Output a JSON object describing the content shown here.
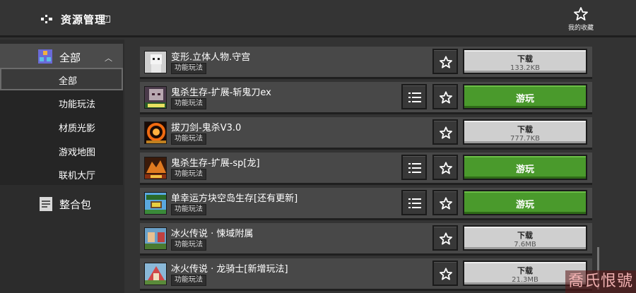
{
  "header": {
    "title": "资源管理",
    "help": "?",
    "favorites_label": "我的收藏"
  },
  "sidebar": {
    "category": {
      "label": "全部",
      "arrow": "︿"
    },
    "subitems": [
      {
        "label": "全部",
        "selected": true
      },
      {
        "label": "功能玩法"
      },
      {
        "label": "材质光影"
      },
      {
        "label": "游戏地图"
      },
      {
        "label": "联机大厅"
      }
    ],
    "pack_label": "整合包"
  },
  "items": [
    {
      "title": "变形.立体人物.守宫",
      "tag": "功能玩法",
      "action": "下载",
      "size": "133.2KB"
    },
    {
      "title": "鬼杀生存-扩展-斩鬼刀ex",
      "tag": "功能玩法",
      "action": "游玩"
    },
    {
      "title": "拔刀剑-鬼杀V3.0",
      "tag": "功能玩法",
      "action": "下载",
      "size": "777.7KB"
    },
    {
      "title": "鬼杀生存-扩展-sp[龙]",
      "tag": "功能玩法",
      "action": "游玩"
    },
    {
      "title": "单幸运方块空岛生存[还有更新]",
      "tag": "功能玩法",
      "action": "游玩"
    },
    {
      "title": "冰火传说 · 悚域附属",
      "tag": "功能玩法",
      "action": "下载",
      "size": "7.6MB"
    },
    {
      "title": "冰火传说 · 龙骑士[新增玩法]",
      "tag": "功能玩法",
      "action": "下载",
      "size": "21.3MB"
    }
  ],
  "watermark": "喬氏恨號",
  "colors": {
    "play": "#4a9a2c",
    "download": "#cfcfcf",
    "row": "#484848"
  }
}
